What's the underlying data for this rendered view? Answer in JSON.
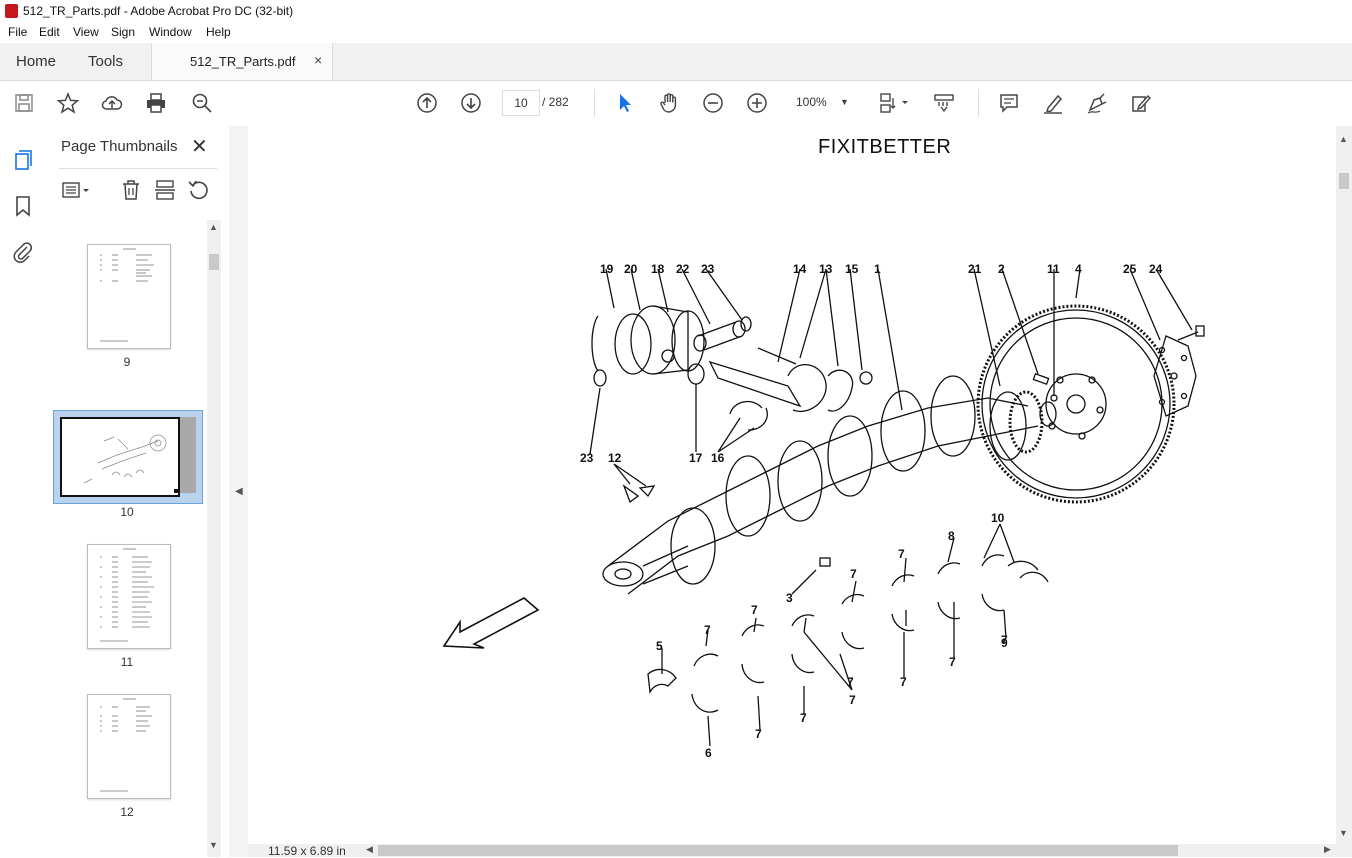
{
  "window": {
    "title": "512_TR_Parts.pdf - Adobe Acrobat Pro DC (32-bit)"
  },
  "menu": [
    "File",
    "Edit",
    "View",
    "Sign",
    "Window",
    "Help"
  ],
  "tabs": {
    "home": "Home",
    "tools": "Tools",
    "document": "512_TR_Parts.pdf",
    "close_glyph": "×"
  },
  "toolbar": {
    "current_page": "10",
    "total_pages": "/ 282",
    "zoom": "100%"
  },
  "thumbnail_panel": {
    "title": "Page Thumbnails",
    "close_glyph": "✕",
    "pages": [
      {
        "label": "9"
      },
      {
        "label": "10",
        "selected": true
      },
      {
        "label": "11"
      },
      {
        "label": "12"
      }
    ]
  },
  "document": {
    "heading": "FIXITBETTER",
    "page_size": "11.59 x 6.89 in",
    "callouts": [
      "19",
      "20",
      "18",
      "22",
      "23",
      "14",
      "13",
      "15",
      "1",
      "21",
      "2",
      "11",
      "4",
      "25",
      "24",
      "23",
      "12",
      "17",
      "16",
      "8",
      "10",
      "7",
      "7",
      "3",
      "7",
      "7",
      "7",
      "5",
      "7",
      "7",
      "7",
      "9",
      "7",
      "6",
      "7",
      "7"
    ]
  },
  "colors": {
    "accent": "#1473e6",
    "selection": "#b7d3ee",
    "app_red": "#c4161c"
  }
}
